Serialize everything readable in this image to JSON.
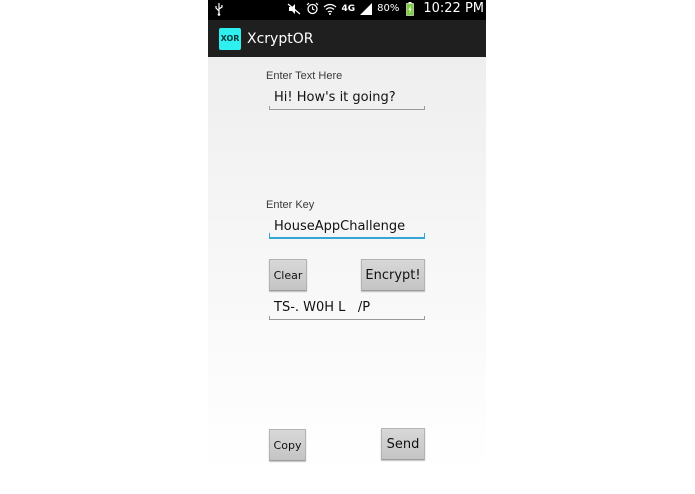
{
  "status_bar": {
    "icons_left": [
      "usb-icon"
    ],
    "icons_right": [
      "mute-icon",
      "alarm-icon",
      "wifi-icon",
      "network-4g-icon",
      "signal-icon",
      "battery-icon"
    ],
    "network": "4G",
    "battery_percent": "80%",
    "time": "10:22 PM"
  },
  "action_bar": {
    "logo_text": "XOR",
    "title": "XcryptOR",
    "logo_color": "#2ff0f0",
    "background": "#1f1f1f"
  },
  "form": {
    "text_label": "Enter Text Here",
    "text_value": "Hi! How's it going?",
    "key_label": "Enter Key",
    "key_value": "HouseAppChallenge",
    "output_value": "TS-. W0H L   /P",
    "focus_color": "#33a6d6"
  },
  "buttons": {
    "clear": "Clear",
    "encrypt": "Encrypt!",
    "copy": "Copy",
    "send": "Send"
  }
}
